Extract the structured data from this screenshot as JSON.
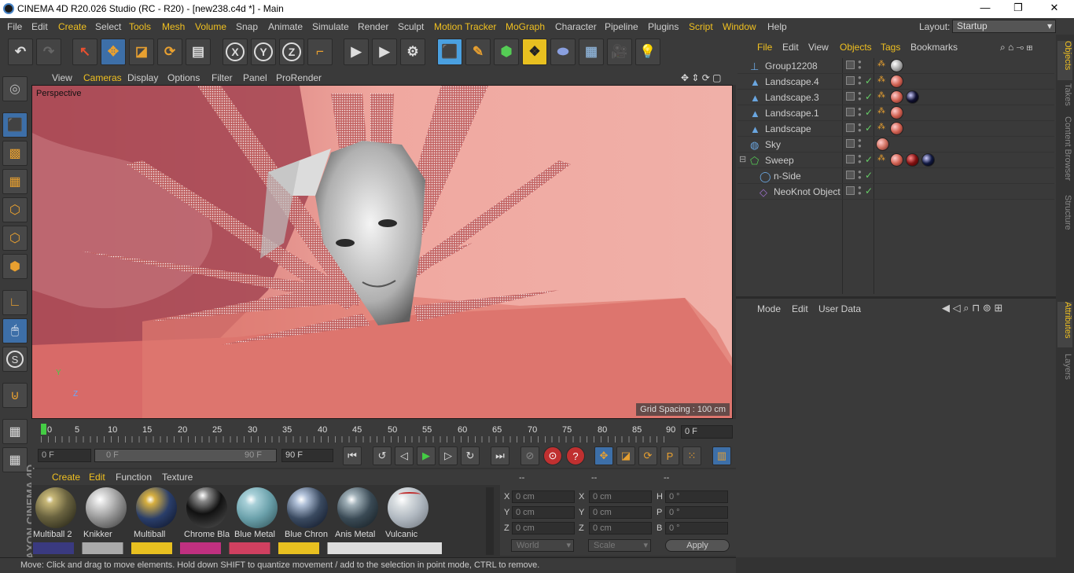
{
  "app": {
    "title": "CINEMA 4D R20.026 Studio (RC - R20) - [new238.c4d *] - Main"
  },
  "window_buttons": {
    "minimize": "—",
    "restore": "❐",
    "close": "✕"
  },
  "menubar": {
    "items": [
      "File",
      "Edit",
      "Create",
      "Select",
      "Tools",
      "Mesh",
      "Volume",
      "Snap",
      "Animate",
      "Simulate",
      "Render",
      "Sculpt",
      "Motion Tracker",
      "MoGraph",
      "Character",
      "Pipeline",
      "Plugins",
      "Script",
      "Window",
      "Help"
    ],
    "highlighted": [
      "Create",
      "Tools",
      "Mesh",
      "Volume",
      "Motion Tracker",
      "MoGraph",
      "Script",
      "Window"
    ],
    "layout_label": "Layout:",
    "layout_value": "Startup"
  },
  "toolbar": {
    "axis_x": "X",
    "axis_y": "Y",
    "axis_z": "Z"
  },
  "viewport": {
    "menu": [
      "View",
      "Cameras",
      "Display",
      "Options",
      "Filter",
      "Panel",
      "ProRender"
    ],
    "label": "Perspective",
    "grid_spacing": "Grid Spacing : 100 cm",
    "axis_y": "Y",
    "axis_z": "Z"
  },
  "timeline": {
    "ticks": [
      "0",
      "5",
      "10",
      "15",
      "20",
      "25",
      "30",
      "35",
      "40",
      "45",
      "50",
      "55",
      "60",
      "65",
      "70",
      "75",
      "80",
      "85",
      "90"
    ],
    "current_frame": "0 F"
  },
  "transport": {
    "start_frame": "0 F",
    "range_start": "0 F",
    "range_end": "90 F",
    "end_frame": "90 F"
  },
  "material_manager": {
    "menu": [
      "Create",
      "Edit",
      "Function",
      "Texture"
    ],
    "materials": [
      {
        "name": "Multiball 2",
        "color": "#6b6440"
      },
      {
        "name": "Knikker",
        "color": "#c8c8c8"
      },
      {
        "name": "Multiball",
        "color": "#2a3e6a"
      },
      {
        "name": "Chrome Bla",
        "color": "#111111"
      },
      {
        "name": "Blue Metal",
        "color": "#6aa0aa"
      },
      {
        "name": "Blue Chron",
        "color": "#3a4a60"
      },
      {
        "name": "Anis Metal",
        "color": "#3a4a55"
      },
      {
        "name": "Vulcanic",
        "color": "#b0b8c0"
      }
    ]
  },
  "coordinates": {
    "headers": [
      "--",
      "--",
      "--"
    ],
    "rows": [
      {
        "l1": "X",
        "v1": "0 cm",
        "l2": "X",
        "v2": "0 cm",
        "l3": "H",
        "v3": "0 °"
      },
      {
        "l1": "Y",
        "v1": "0 cm",
        "l2": "Y",
        "v2": "0 cm",
        "l3": "P",
        "v3": "0 °"
      },
      {
        "l1": "Z",
        "v1": "0 cm",
        "l2": "Z",
        "v2": "0 cm",
        "l3": "B",
        "v3": "0 °"
      }
    ],
    "world": "World",
    "scale": "Scale",
    "apply": "Apply"
  },
  "status": {
    "text": "Move: Click and drag to move elements. Hold down SHIFT to quantize movement / add to the selection in point mode, CTRL to remove."
  },
  "object_manager": {
    "menu": [
      "File",
      "Edit",
      "View",
      "Objects",
      "Tags",
      "Bookmarks"
    ],
    "highlighted": [
      "File",
      "Objects",
      "Tags"
    ],
    "objects": [
      {
        "name": "Group12208",
        "indent": 0,
        "icon": "group",
        "tags": [
          "#bbbbbb"
        ]
      },
      {
        "name": "Landscape.4",
        "indent": 0,
        "icon": "landscape",
        "tags": [
          "#d06050"
        ]
      },
      {
        "name": "Landscape.3",
        "indent": 0,
        "icon": "landscape",
        "tags": [
          "#d06050",
          "#101030"
        ]
      },
      {
        "name": "Landscape.1",
        "indent": 0,
        "icon": "landscape",
        "tags": [
          "#d06050"
        ]
      },
      {
        "name": "Landscape",
        "indent": 0,
        "icon": "landscape",
        "tags": [
          "#d06050"
        ]
      },
      {
        "name": "Sky",
        "indent": 0,
        "icon": "sky",
        "tags": [
          "#d07060"
        ]
      },
      {
        "name": "Sweep",
        "indent": 0,
        "icon": "sweep",
        "tags": [
          "#d06050",
          "#801010",
          "#101840"
        ]
      },
      {
        "name": "n-Side",
        "indent": 1,
        "icon": "nside",
        "tags": []
      },
      {
        "name": "NeoKnot Object",
        "indent": 1,
        "icon": "neoknot",
        "tags": []
      }
    ]
  },
  "attribute_manager": {
    "menu": [
      "Mode",
      "Edit",
      "User Data"
    ]
  },
  "right_tabs": {
    "objects": "Objects",
    "takes": "Takes",
    "content_browser": "Content Browser",
    "structure": "Structure",
    "attributes": "Attributes",
    "layers": "Layers"
  },
  "brand": {
    "vertical_logo": "MAXON CINEMA 4D"
  }
}
